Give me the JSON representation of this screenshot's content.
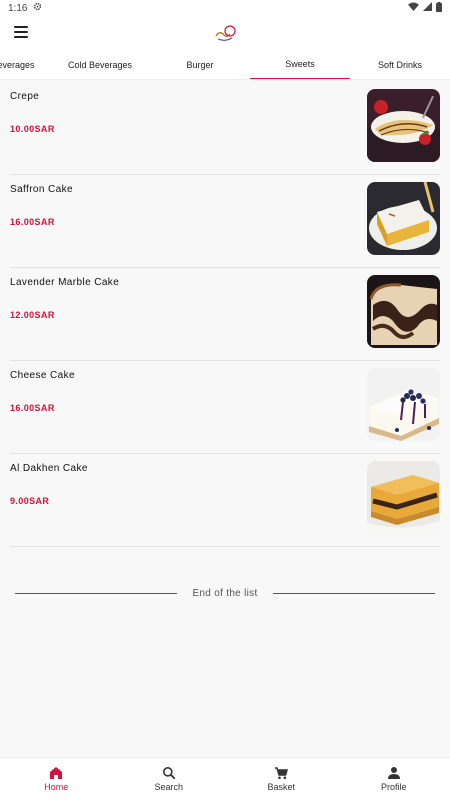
{
  "status": {
    "time": "1:16"
  },
  "tabs": [
    {
      "label": "everages"
    },
    {
      "label": "Cold Beverages"
    },
    {
      "label": "Burger"
    },
    {
      "label": "Sweets",
      "active": true
    },
    {
      "label": "Soft Drinks"
    }
  ],
  "items": [
    {
      "name": "Crepe",
      "price": "10.00SAR"
    },
    {
      "name": "Saffron Cake",
      "price": "16.00SAR"
    },
    {
      "name": "Lavender Marble Cake",
      "price": "12.00SAR"
    },
    {
      "name": "Cheese Cake",
      "price": "16.00SAR"
    },
    {
      "name": "Al Dakhen Cake",
      "price": "9.00SAR"
    }
  ],
  "end_of_list": "End of the list",
  "nav": [
    {
      "label": "Home",
      "icon": "home-icon",
      "active": true
    },
    {
      "label": "Search",
      "icon": "search-icon"
    },
    {
      "label": "Basket",
      "icon": "cart-icon"
    },
    {
      "label": "Profile",
      "icon": "person-icon"
    }
  ],
  "colors": {
    "accent": "#d6103a",
    "background": "#f8f8f8"
  }
}
